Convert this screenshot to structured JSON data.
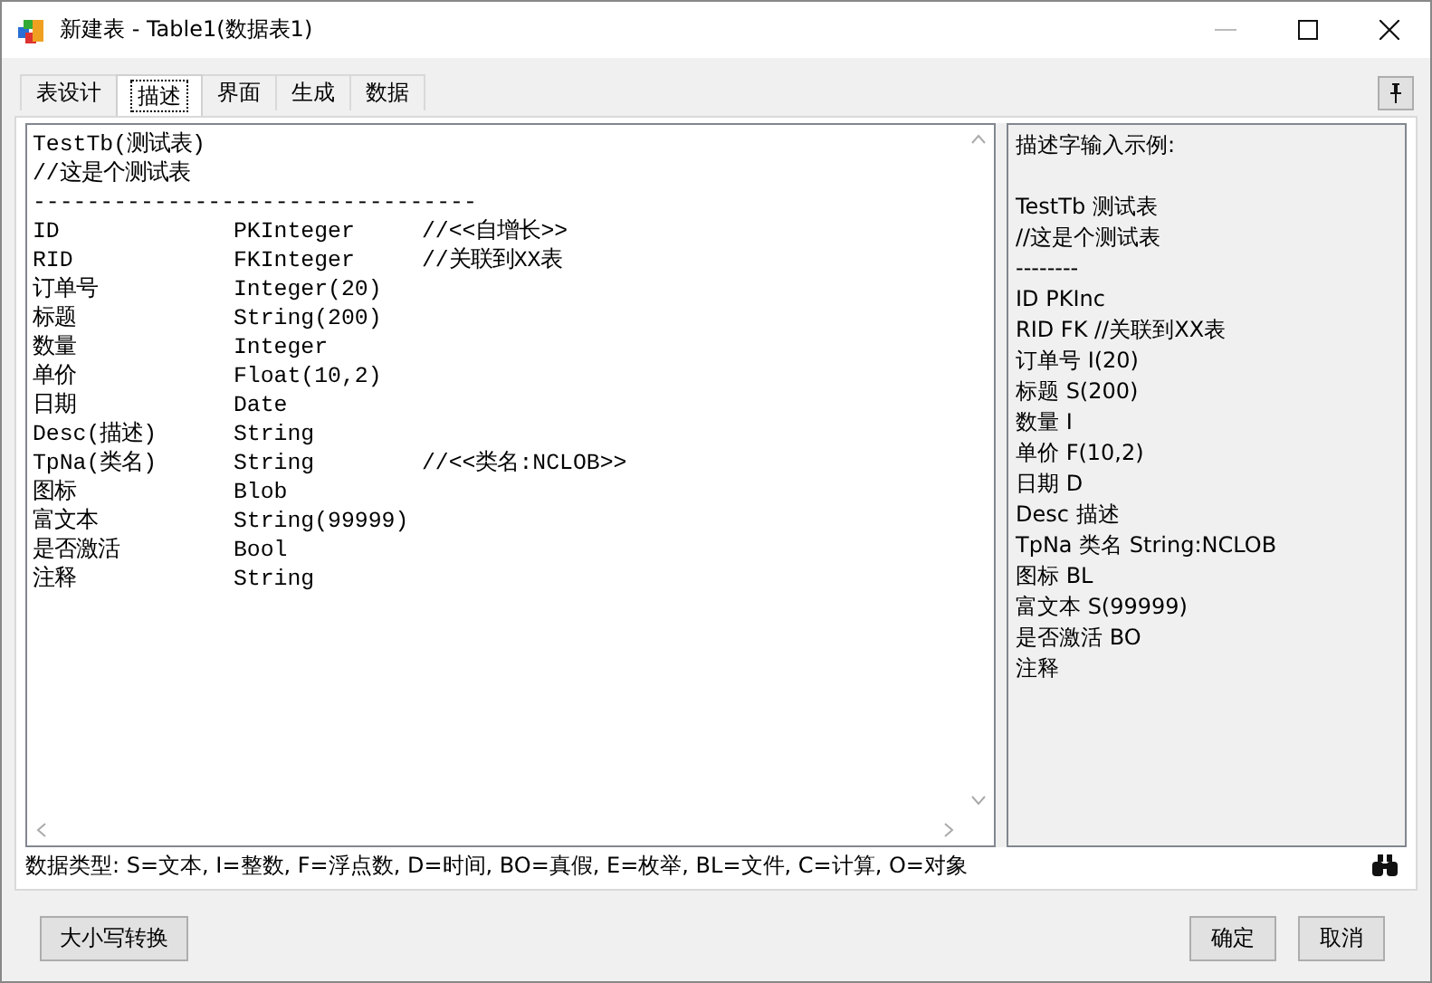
{
  "window": {
    "title": "新建表 - Table1(数据表1)"
  },
  "tabs": [
    {
      "label": "表设计",
      "selected": false
    },
    {
      "label": "描述",
      "selected": true
    },
    {
      "label": "界面",
      "selected": false
    },
    {
      "label": "生成",
      "selected": false
    },
    {
      "label": "数据",
      "selected": false
    }
  ],
  "editor": {
    "header": [
      "TestTb(测试表)",
      "//这是个测试表",
      "---------------------------------"
    ],
    "fields": [
      {
        "name": "ID",
        "type": "PKInteger",
        "comment": "//<<自增长>>"
      },
      {
        "name": "RID",
        "type": "FKInteger",
        "comment": "//关联到XX表"
      },
      {
        "name": "订单号",
        "type": "Integer(20)"
      },
      {
        "name": "标题",
        "type": "String(200)"
      },
      {
        "name": "数量",
        "type": "Integer"
      },
      {
        "name": "单价",
        "type": "Float(10,2)"
      },
      {
        "name": "日期",
        "type": "Date"
      },
      {
        "name": "Desc(描述)",
        "type": "String"
      },
      {
        "name": "TpNa(类名)",
        "type": "String",
        "comment": "//<<类名:NCLOB>>"
      },
      {
        "name": "图标",
        "type": "Blob"
      },
      {
        "name": "富文本",
        "type": "String(99999)"
      },
      {
        "name": "是否激活",
        "type": "Bool"
      },
      {
        "name": "注释",
        "type": "String"
      }
    ]
  },
  "example": {
    "title": "描述字输入示例:",
    "lines": [
      "TestTb 测试表",
      "//这是个测试表",
      "--------",
      "ID PKInc",
      "RID FK //关联到XX表",
      "订单号 I(20)",
      "标题 S(200)",
      "数量 I",
      "单价 F(10,2)",
      "日期 D",
      "Desc 描述",
      "TpNa 类名 String:NCLOB",
      "图标 BL",
      "富文本 S(99999)",
      "是否激活 BO",
      "注释"
    ]
  },
  "status_bar": {
    "text": "数据类型: S=文本, I=整数, F=浮点数, D=时间, BO=真假, E=枚举, BL=文件, C=计算, O=对象"
  },
  "buttons": {
    "left": "大小写转换",
    "ok": "确定",
    "cancel": "取消"
  }
}
